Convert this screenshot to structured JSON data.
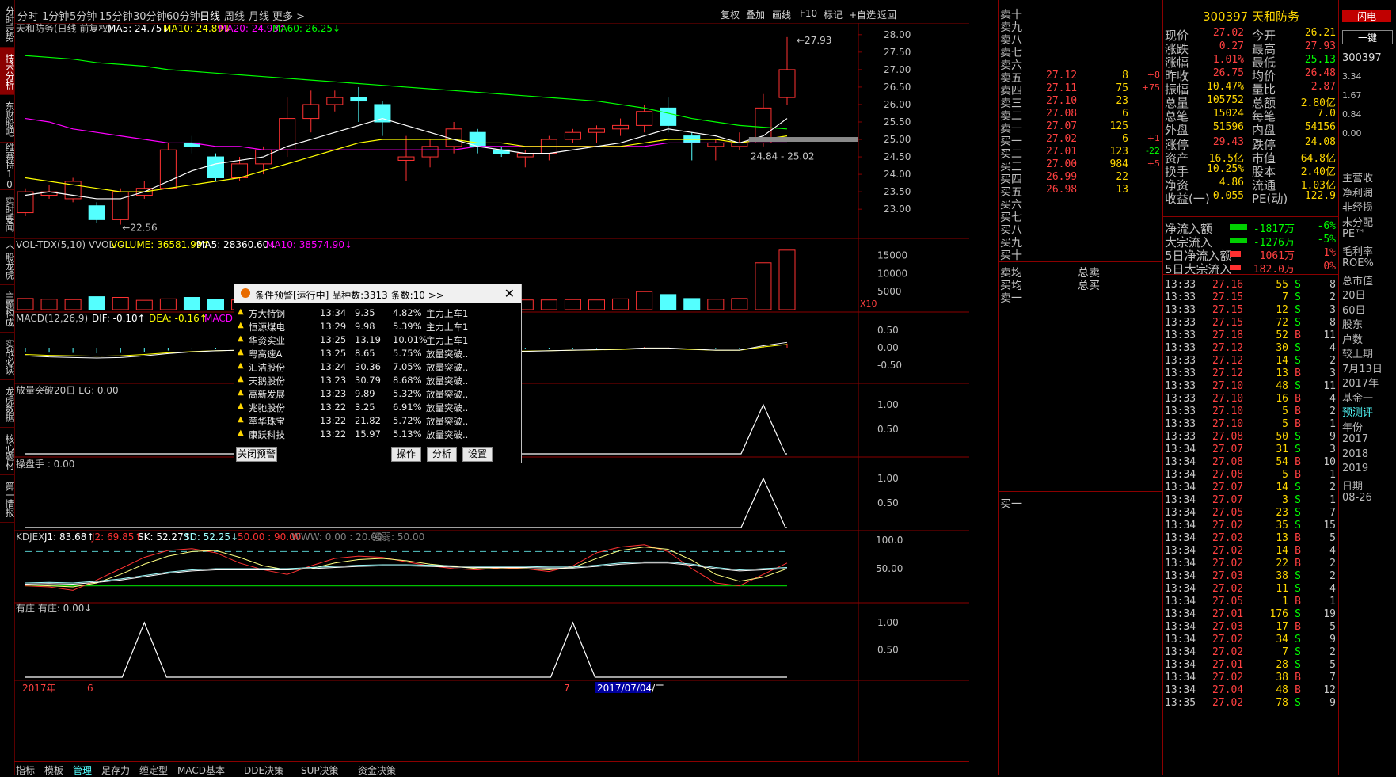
{
  "colors": {
    "up": "#ff3232",
    "down": "#54ffff",
    "ma5": "#ffffff",
    "ma10": "#ffff00",
    "ma20": "#ff00ff",
    "ma60": "#00ff00",
    "accent_red": "#8b0000"
  },
  "left_tabs": [
    "分时走势",
    "技术分析",
    "东财股吧",
    "维赛特10",
    "实时要闻",
    "个股龙虎",
    "主题构成",
    "实战必读",
    "龙虎数据",
    "核心题材",
    "第一情报"
  ],
  "periods": [
    "分时",
    "1分钟",
    "5分钟",
    "15分钟",
    "30分钟",
    "60分钟",
    "日线",
    "周线",
    "月线",
    "更多 >"
  ],
  "active_period": "日线",
  "toolbar": [
    "复权",
    "叠加",
    "画线",
    "F10",
    "标记",
    "+自选",
    "返回"
  ],
  "main": {
    "title": "天和防务(日线 前复权)",
    "ma5": "MA5: 24.75↓",
    "ma10": "MA10: 24.89↓",
    "ma20": "MA20: 24.93↑",
    "ma60": "MA60: 26.25↓",
    "yaxis": [
      "28.00",
      "27.50",
      "27.00",
      "26.50",
      "26.00",
      "25.50",
      "25.00",
      "24.50",
      "24.00",
      "23.50",
      "23.00"
    ],
    "high_label": "27.93",
    "low_label": "22.56",
    "range_label": "24.84 - 25.02",
    "candles": [
      [
        22.9,
        23.5,
        22.8,
        23.6
      ],
      [
        23.4,
        23.5,
        23.3,
        23.7
      ],
      [
        23.3,
        23.8,
        23.2,
        23.9
      ],
      [
        23.1,
        22.7,
        22.6,
        23.2
      ],
      [
        22.7,
        23.5,
        22.56,
        23.6
      ],
      [
        23.4,
        23.6,
        23.3,
        23.8
      ],
      [
        23.6,
        24.7,
        23.6,
        24.9
      ],
      [
        24.9,
        24.8,
        24.6,
        25.1
      ],
      [
        24.5,
        23.9,
        23.8,
        24.6
      ],
      [
        23.9,
        24.3,
        23.8,
        24.5
      ],
      [
        24.3,
        24.7,
        24.0,
        24.8
      ],
      [
        24.7,
        25.6,
        24.5,
        26.2
      ],
      [
        25.6,
        26.0,
        25.2,
        26.4
      ],
      [
        26.0,
        26.2,
        25.8,
        26.4
      ],
      [
        26.2,
        26.1,
        25.5,
        26.5
      ],
      [
        26.0,
        25.5,
        25.1,
        26.1
      ],
      [
        24.4,
        24.5,
        23.8,
        25.1
      ],
      [
        24.5,
        24.8,
        24.2,
        25.0
      ],
      [
        24.8,
        25.3,
        24.6,
        25.5
      ],
      [
        25.2,
        24.8,
        24.6,
        25.3
      ],
      [
        24.7,
        24.6,
        24.5,
        24.8
      ],
      [
        24.5,
        24.6,
        24.2,
        24.7
      ],
      [
        24.6,
        25.0,
        24.4,
        25.1
      ],
      [
        25.0,
        25.2,
        24.9,
        25.3
      ],
      [
        25.2,
        25.3,
        24.9,
        25.4
      ],
      [
        25.3,
        25.4,
        25.1,
        25.6
      ],
      [
        25.4,
        25.8,
        25.2,
        26.0
      ],
      [
        25.9,
        25.4,
        25.2,
        26.2
      ],
      [
        25.1,
        24.9,
        24.4,
        25.2
      ],
      [
        24.8,
        24.9,
        24.4,
        25.0
      ],
      [
        24.8,
        24.9,
        24.7,
        25.2
      ],
      [
        24.9,
        25.9,
        24.8,
        26.3
      ],
      [
        26.2,
        27.0,
        26.0,
        27.93
      ]
    ],
    "ma5_line": [
      23.4,
      23.5,
      23.4,
      23.3,
      23.3,
      23.5,
      23.8,
      24.1,
      24.3,
      24.4,
      24.5,
      24.8,
      25.0,
      25.2,
      25.4,
      25.6,
      25.4,
      25.2,
      25.0,
      24.8,
      24.7,
      24.6,
      24.6,
      24.7,
      24.8,
      24.9,
      25.1,
      25.3,
      25.2,
      25.1,
      24.9,
      25.1,
      25.6
    ],
    "ma10_line": [
      23.9,
      23.8,
      23.7,
      23.6,
      23.5,
      23.5,
      23.6,
      23.7,
      23.8,
      23.9,
      24.1,
      24.3,
      24.5,
      24.7,
      24.9,
      25.0,
      25.0,
      25.0,
      25.0,
      24.9,
      24.9,
      24.8,
      24.8,
      24.8,
      24.8,
      24.8,
      24.9,
      25.0,
      25.0,
      25.0,
      24.9,
      25.0,
      25.1
    ],
    "ma20_line": [
      25.6,
      25.5,
      25.3,
      25.2,
      25.1,
      25.0,
      24.9,
      24.9,
      24.8,
      24.8,
      24.7,
      24.7,
      24.7,
      24.7,
      24.7,
      24.7,
      24.7,
      24.7,
      24.7,
      24.8,
      24.8,
      24.8,
      24.8,
      24.8,
      24.8,
      24.8,
      24.8,
      24.9,
      24.9,
      24.9,
      24.9,
      24.9,
      24.9
    ],
    "ma60_line": [
      27.4,
      27.35,
      27.3,
      27.2,
      27.15,
      27.1,
      27.0,
      26.95,
      26.9,
      26.85,
      26.8,
      26.75,
      26.7,
      26.65,
      26.6,
      26.55,
      26.5,
      26.45,
      26.4,
      26.35,
      26.3,
      26.25,
      26.2,
      26.15,
      26.1,
      26.0,
      25.9,
      25.75,
      25.6,
      25.5,
      25.4,
      25.35,
      25.3
    ]
  },
  "vol": {
    "title": "VOL-TDX(5,10)  VVOL: -",
    "volume": "VOLUME: 36581.99↑",
    "ma5": "MA5: 28360.60↓",
    "ma10": "MA10: 38574.90↓",
    "yaxis": [
      "15000",
      "10000",
      "5000"
    ],
    "x10": "X10"
  },
  "macd": {
    "title": "MACD(12,26,9)",
    "dif": "DIF: -0.10↑",
    "dea": "DEA: -0.16↑",
    "macd": "MACD: 0.12↑",
    "yaxis": [
      "0.50",
      "0.00",
      "-0.50"
    ]
  },
  "fl": {
    "title": "放量突破20日  LG: 0.00",
    "yaxis": [
      "1.00",
      "0.50"
    ]
  },
  "cps": {
    "title": "操盘手 : 0.00",
    "yaxis": [
      "1.00",
      "0.50"
    ]
  },
  "kdj": {
    "title": "KDJEX",
    "j1": "J1: 83.68↑",
    "j2": "J2: 69.85↑",
    "sk": "SK: 52.27↑",
    "sd": "SD: 52.25↓",
    "l1": "50.00 : 90.00",
    "www": "WWW: 0.00 : 20.00",
    "qr": "强弱: 50.00",
    "yaxis": [
      "100.0",
      "50.00"
    ]
  },
  "yz": {
    "title": "有庄  有庄: 0.00↓",
    "yaxis": [
      "1.00",
      "0.50"
    ]
  },
  "date_strip": {
    "year": "2017年",
    "m6": "6",
    "m7": "7",
    "cursor": "2017/07/04/二"
  },
  "bottom_tabs": [
    "指标",
    "模板",
    "管理",
    "足存力",
    "缠定型",
    "MACD基本",
    "DDE决策",
    "SUP决策",
    "资金决策"
  ],
  "popup": {
    "title": "条件预警[运行中] 品种数:3313 条数:10  >>",
    "rows": [
      [
        "方大特钢",
        "13:34",
        "9.35",
        "4.82%",
        "主力上车1"
      ],
      [
        "恒源煤电",
        "13:29",
        "9.98",
        "5.39%",
        "主力上车1"
      ],
      [
        "华资实业",
        "13:25",
        "13.19",
        "10.01%",
        "主力上车1"
      ],
      [
        "粤高速A",
        "13:25",
        "8.65",
        "5.75%",
        "放量突破.."
      ],
      [
        "汇洁股份",
        "13:24",
        "30.36",
        "7.05%",
        "放量突破.."
      ],
      [
        "天鹅股份",
        "13:23",
        "30.79",
        "8.68%",
        "放量突破.."
      ],
      [
        "高新发展",
        "13:23",
        "9.89",
        "5.32%",
        "放量突破.."
      ],
      [
        "兆驰股份",
        "13:22",
        "3.25",
        "6.91%",
        "放量突破.."
      ],
      [
        "萃华珠宝",
        "13:22",
        "21.82",
        "5.72%",
        "放量突破.."
      ],
      [
        "康跃科技",
        "13:22",
        "15.97",
        "5.13%",
        "放量突破.."
      ]
    ],
    "close_btn": "关闭预警",
    "op_btn": "操作",
    "an_btn": "分析",
    "set_btn": "设置"
  },
  "book": {
    "sell": [
      [
        "卖十",
        "",
        "",
        ""
      ],
      [
        "卖九",
        "",
        "",
        ""
      ],
      [
        "卖八",
        "",
        "",
        ""
      ],
      [
        "卖七",
        "",
        "",
        ""
      ],
      [
        "卖六",
        "",
        "",
        ""
      ],
      [
        "卖五",
        "27.12",
        "8",
        "+8"
      ],
      [
        "卖四",
        "27.11",
        "75",
        "+75"
      ],
      [
        "卖三",
        "27.10",
        "23",
        ""
      ],
      [
        "卖二",
        "27.08",
        "6",
        ""
      ],
      [
        "卖一",
        "27.07",
        "125",
        ""
      ]
    ],
    "buy": [
      [
        "买一",
        "27.02",
        "6",
        "+1"
      ],
      [
        "买二",
        "27.01",
        "123",
        "-22"
      ],
      [
        "买三",
        "27.00",
        "984",
        "+5"
      ],
      [
        "买四",
        "26.99",
        "22",
        ""
      ],
      [
        "买五",
        "26.98",
        "13",
        ""
      ],
      [
        "买六",
        "",
        "",
        ""
      ],
      [
        "买七",
        "",
        "",
        ""
      ],
      [
        "买八",
        "",
        "",
        ""
      ],
      [
        "买九",
        "",
        "",
        ""
      ],
      [
        "买十",
        "",
        "",
        ""
      ]
    ],
    "avg_sell": "卖均",
    "avg_buy": "买均",
    "total_sell": "总卖",
    "total_buy": "总买",
    "buy1_a": "卖一",
    "buy1_b": "买一"
  },
  "quote": {
    "code": "300397",
    "name": "天和防务",
    "rows": [
      [
        "现价",
        "27.02",
        "今开",
        "26.21"
      ],
      [
        "涨跌",
        "0.27",
        "最高",
        "27.93"
      ],
      [
        "涨幅",
        "1.01%",
        "最低",
        "25.13"
      ],
      [
        "昨收",
        "26.75",
        "均价",
        "26.48"
      ],
      [
        "振幅",
        "10.47%",
        "量比",
        "2.87"
      ],
      [
        "总量",
        "105752",
        "总额",
        "2.80亿"
      ],
      [
        "总笔",
        "15024",
        "每笔",
        "7.0"
      ],
      [
        "外盘",
        "51596",
        "内盘",
        "54156"
      ],
      [
        "涨停",
        "29.43",
        "跌停",
        "24.08"
      ],
      [
        "资产",
        "16.5亿",
        "市值",
        "64.8亿"
      ],
      [
        "换手",
        "10.25%",
        "股本",
        "2.40亿"
      ],
      [
        "净资",
        "4.86",
        "流通",
        "1.03亿"
      ],
      [
        "收益(一)",
        "0.055",
        "PE(动)",
        "122.9"
      ]
    ],
    "flows": [
      [
        "净流入额",
        "-1817万",
        "-6%"
      ],
      [
        "大宗流入",
        "-1276万",
        "-5%"
      ],
      [
        "5日净流入额",
        "1061万",
        "1%"
      ],
      [
        "5日大宗流入",
        "182.0万",
        "0%"
      ]
    ]
  },
  "ticks": [
    [
      "13:33",
      "27.16",
      "55",
      "S",
      "8"
    ],
    [
      "13:33",
      "27.15",
      "7",
      "S",
      "2"
    ],
    [
      "13:33",
      "27.15",
      "12",
      "S",
      "3"
    ],
    [
      "13:33",
      "27.15",
      "72",
      "S",
      "8"
    ],
    [
      "13:33",
      "27.18",
      "52",
      "B",
      "11"
    ],
    [
      "13:33",
      "27.12",
      "30",
      "S",
      "4"
    ],
    [
      "13:33",
      "27.12",
      "14",
      "S",
      "2"
    ],
    [
      "13:33",
      "27.12",
      "13",
      "B",
      "3"
    ],
    [
      "13:33",
      "27.10",
      "48",
      "S",
      "11"
    ],
    [
      "13:33",
      "27.10",
      "16",
      "B",
      "4"
    ],
    [
      "13:33",
      "27.10",
      "5",
      "B",
      "2"
    ],
    [
      "13:33",
      "27.10",
      "5",
      "B",
      "1"
    ],
    [
      "13:33",
      "27.08",
      "50",
      "S",
      "9"
    ],
    [
      "13:34",
      "27.07",
      "31",
      "S",
      "3"
    ],
    [
      "13:34",
      "27.08",
      "54",
      "B",
      "10"
    ],
    [
      "13:34",
      "27.08",
      "5",
      "B",
      "1"
    ],
    [
      "13:34",
      "27.07",
      "14",
      "S",
      "2"
    ],
    [
      "13:34",
      "27.07",
      "3",
      "S",
      "1"
    ],
    [
      "13:34",
      "27.05",
      "23",
      "S",
      "7"
    ],
    [
      "13:34",
      "27.02",
      "35",
      "S",
      "15"
    ],
    [
      "13:34",
      "27.02",
      "13",
      "B",
      "5"
    ],
    [
      "13:34",
      "27.02",
      "14",
      "B",
      "4"
    ],
    [
      "13:34",
      "27.02",
      "22",
      "B",
      "2"
    ],
    [
      "13:34",
      "27.03",
      "38",
      "S",
      "2"
    ],
    [
      "13:34",
      "27.02",
      "11",
      "S",
      "4"
    ],
    [
      "13:34",
      "27.05",
      "1",
      "B",
      "1"
    ],
    [
      "13:34",
      "27.01",
      "176",
      "S",
      "19"
    ],
    [
      "13:34",
      "27.03",
      "17",
      "B",
      "5"
    ],
    [
      "13:34",
      "27.02",
      "34",
      "S",
      "9"
    ],
    [
      "13:34",
      "27.02",
      "7",
      "S",
      "2"
    ],
    [
      "13:34",
      "27.01",
      "28",
      "S",
      "5"
    ],
    [
      "13:34",
      "27.02",
      "38",
      "B",
      "7"
    ],
    [
      "13:34",
      "27.04",
      "48",
      "B",
      "12"
    ],
    [
      "13:35",
      "27.02",
      "78",
      "S",
      "9"
    ]
  ],
  "extra": {
    "top_btn": "闪电",
    "btn2": "一键",
    "code": "300397",
    "vals": [
      "3.34",
      "1.67",
      "0.84",
      "0.00"
    ],
    "items": [
      "主营收",
      "净利润",
      "非经损",
      "未分配",
      "PE™",
      "毛利率",
      "ROE%",
      "总市值",
      "20日",
      "60日",
      "股东",
      "户数",
      "较上期",
      "7月13日",
      "2017年",
      "基金一",
      "预测评",
      "年份",
      "2017",
      "2018",
      "2019",
      "日期",
      "08-26"
    ]
  }
}
